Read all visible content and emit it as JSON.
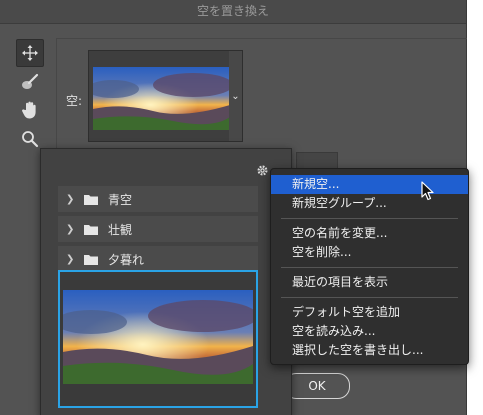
{
  "dialog": {
    "title": "空を置き換え",
    "sky_label": "空:",
    "ok_label": "OK"
  },
  "tools": [
    {
      "icon": "move-icon"
    },
    {
      "icon": "sky-brush-icon"
    },
    {
      "icon": "hand-icon"
    },
    {
      "icon": "zoom-icon"
    }
  ],
  "picker": {
    "groups": [
      "青空",
      "壮観",
      "夕暮れ"
    ]
  },
  "menu": {
    "items": [
      "新規空...",
      "新規空グループ...",
      "空の名前を変更...",
      "空を削除...",
      "最近の項目を表示",
      "デフォルト空を追加",
      "空を読み込み...",
      "選択した空を書き出し..."
    ],
    "highlighted_index": 0
  },
  "colors": {
    "dialog_bg": "#535353",
    "menu_bg": "#2f2f2f",
    "highlight": "#1f5fd0",
    "selection_border": "#2aa3e6"
  }
}
